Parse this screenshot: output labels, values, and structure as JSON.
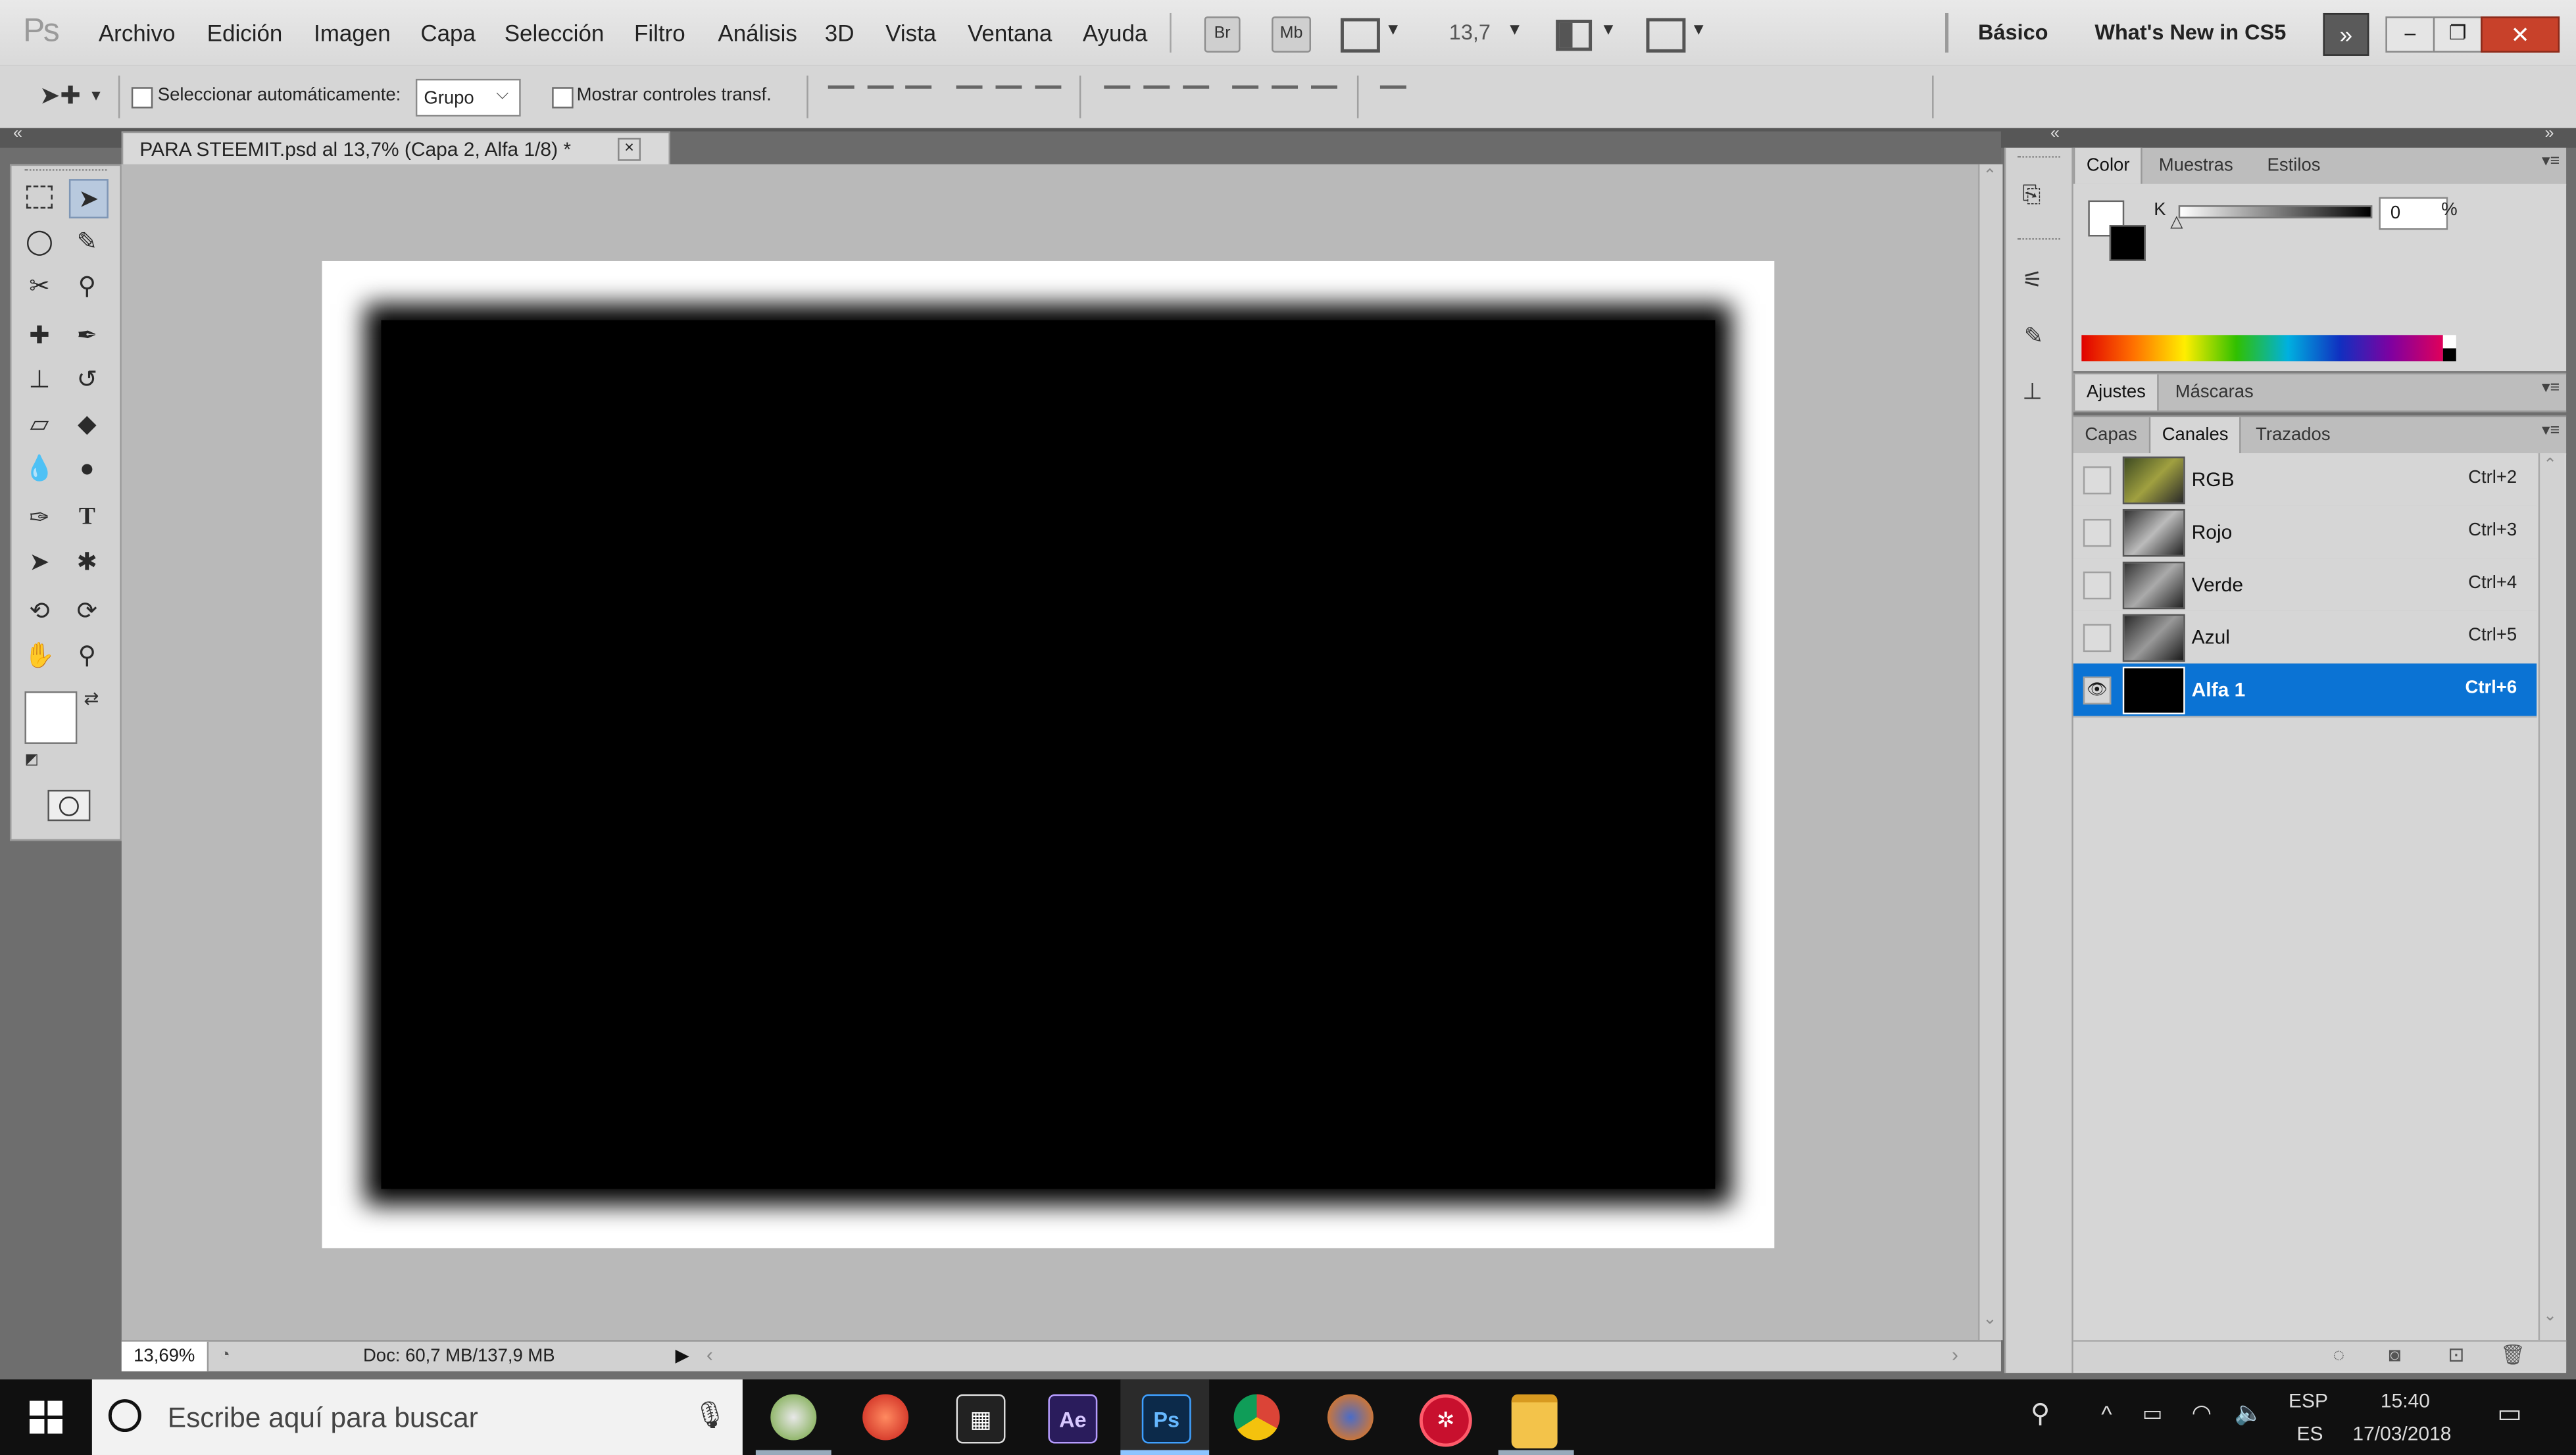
{
  "app": {
    "logo": "Ps",
    "menu": [
      "Archivo",
      "Edición",
      "Imagen",
      "Capa",
      "Selección",
      "Filtro",
      "Análisis",
      "3D",
      "Vista",
      "Ventana",
      "Ayuda"
    ],
    "menubar_buttons": [
      "Br",
      "Mb"
    ],
    "zoom_value": "13,7",
    "workspace": "Básico",
    "whats_new": "What's New in CS5"
  },
  "options": {
    "auto_select_label": "Seleccionar automáticamente:",
    "auto_select_value": "Grupo",
    "show_transform_label": "Mostrar controles transf."
  },
  "document": {
    "tab_title": "PARA STEEMIT.psd al 13,7% (Capa 2, Alfa 1/8) *",
    "close": "×"
  },
  "status": {
    "zoom": "13,69%",
    "doc": "Doc: 60,7 MB/137,9 MB"
  },
  "color_panel": {
    "tabs": [
      "Color",
      "Muestras",
      "Estilos"
    ],
    "channel_label": "K",
    "value": "0",
    "unit": "%"
  },
  "adjust_panel": {
    "tabs": [
      "Ajustes",
      "Máscaras"
    ]
  },
  "channels_panel": {
    "tabs": [
      "Capas",
      "Canales",
      "Trazados"
    ],
    "rows": [
      {
        "name": "RGB",
        "shortcut": "Ctrl+2"
      },
      {
        "name": "Rojo",
        "shortcut": "Ctrl+3"
      },
      {
        "name": "Verde",
        "shortcut": "Ctrl+4"
      },
      {
        "name": "Azul",
        "shortcut": "Ctrl+5"
      },
      {
        "name": "Alfa 1",
        "shortcut": "Ctrl+6"
      }
    ]
  },
  "taskbar": {
    "search_placeholder": "Escribe aquí para buscar",
    "apps": [
      "Ae",
      "Ps"
    ],
    "lang_top": "ESP",
    "lang_bottom": "ES",
    "time": "15:40",
    "date": "17/03/2018"
  },
  "colors": {
    "selection_blue": "#0b73d4",
    "ae_purple": "#2a1c5c",
    "ps_blue": "#0c2a4a"
  }
}
